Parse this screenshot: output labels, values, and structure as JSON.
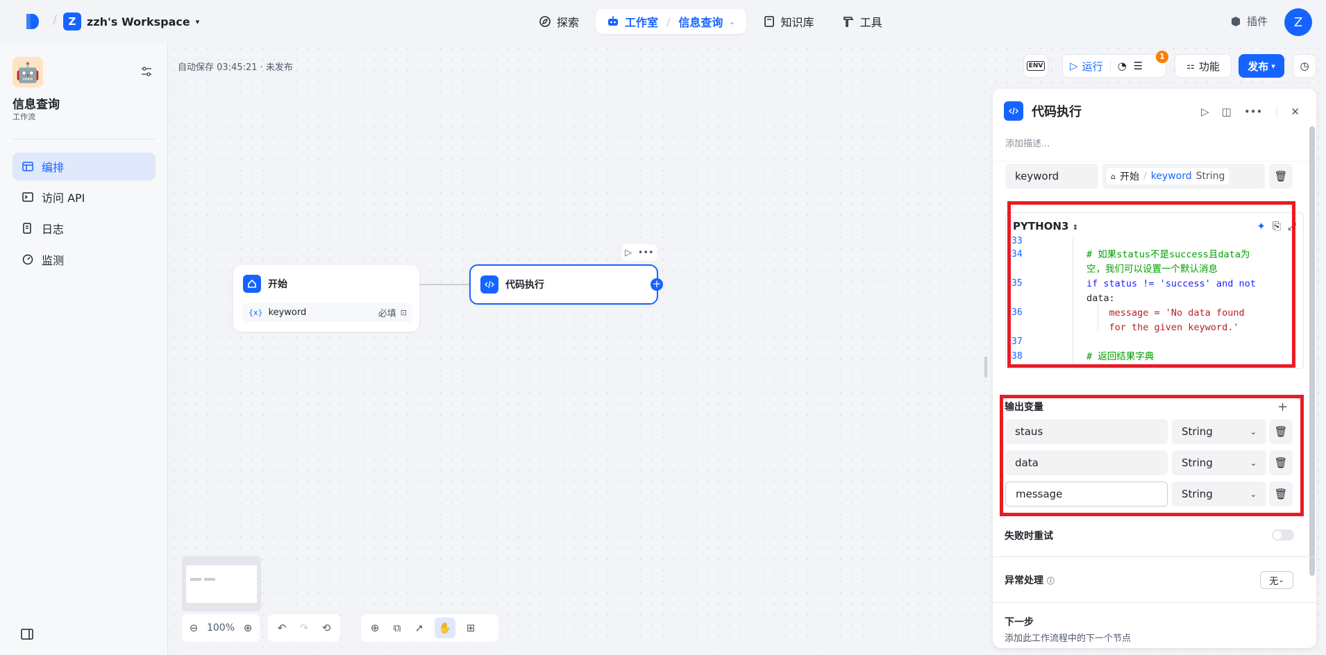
{
  "workspace": {
    "badge": "Z",
    "name": "zzh's Workspace"
  },
  "nav": {
    "explore": "探索",
    "studio": "工作室",
    "current": "信息查询",
    "knowledge": "知识库",
    "tools": "工具"
  },
  "plugin_label": "插件",
  "user_avatar": "Z",
  "app": {
    "name": "信息查询",
    "type": "工作流"
  },
  "sidebar": {
    "items": [
      {
        "label": "编排",
        "icon": "layout-icon",
        "active": true
      },
      {
        "label": "访问 API",
        "icon": "terminal-icon",
        "active": false
      },
      {
        "label": "日志",
        "icon": "log-icon",
        "active": false
      },
      {
        "label": "监测",
        "icon": "monitor-icon",
        "active": false
      }
    ]
  },
  "autosave": "自动保存 03:45:21 · 未发布",
  "canvas": {
    "start_node": {
      "title": "开始",
      "param_name": "keyword",
      "param_required": "必填"
    },
    "code_node": {
      "title": "代码执行"
    },
    "zoom": "100%"
  },
  "toolbar": {
    "env": "ENV",
    "run": "运行",
    "features": "功能",
    "publish": "发布",
    "badge_count": "1"
  },
  "panel": {
    "title": "代码执行",
    "description_placeholder": "添加描述...",
    "input_var": {
      "name": "keyword",
      "ref_node": "开始",
      "ref_var": "keyword",
      "ref_type": "String"
    },
    "code": {
      "language": "PYTHON3",
      "lines": [
        {
          "no": "33",
          "text": ""
        },
        {
          "no": "34",
          "text": "# 如果status不是success且data为"
        },
        {
          "no": "",
          "text": "空，我们可以设置一个默认消息"
        },
        {
          "no": "35",
          "text": "if status != 'success' and not"
        },
        {
          "no": "",
          "text": "data:"
        },
        {
          "no": "36",
          "text": "    message = 'No data found"
        },
        {
          "no": "",
          "text": "    for the given keyword.'"
        },
        {
          "no": "37",
          "text": ""
        },
        {
          "no": "38",
          "text": "# 返回结果字典"
        }
      ]
    },
    "output_title": "输出变量",
    "outputs": [
      {
        "name": "staus",
        "type": "String"
      },
      {
        "name": "data",
        "type": "String"
      },
      {
        "name": "message",
        "type": "String"
      }
    ],
    "retry_label": "失败时重试",
    "error_label": "异常处理",
    "error_value": "无",
    "next_title": "下一步",
    "next_desc": "添加此工作流程中的下一个节点"
  },
  "colors": {
    "accent": "#1664ff",
    "highlight": "#e91b24",
    "badge": "#ff7d00"
  }
}
